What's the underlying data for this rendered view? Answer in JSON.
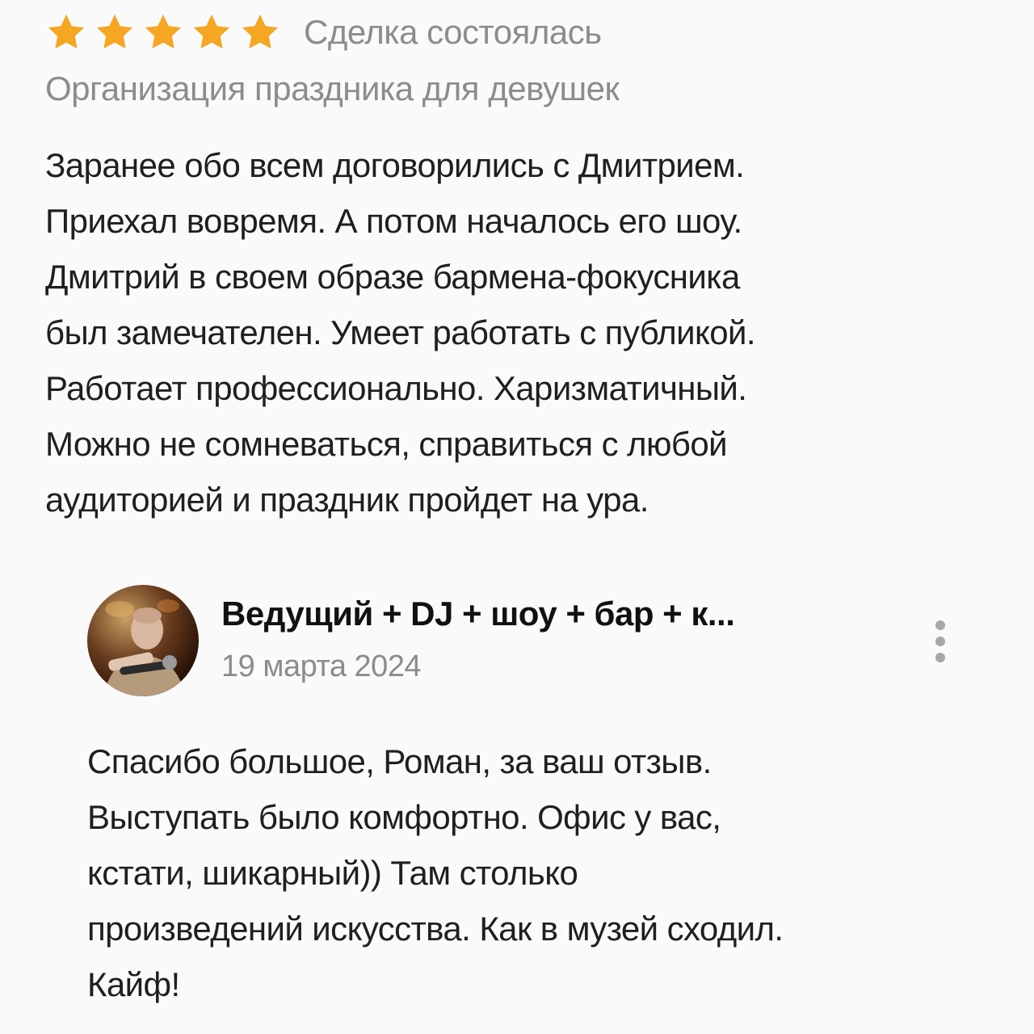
{
  "review": {
    "rating": 5,
    "rating_max": 5,
    "star_color": "#f5a623",
    "deal_status": "Сделка состоялась",
    "category": "Организация праздника для девушек",
    "text_lines": [
      "Заранее обо всем договорились с Дмитрием.",
      "Приехал вовремя. А потом началось его шоу.",
      "Дмитрий в своем образе бармена-фокусника",
      "был замечателен. Умеет работать с публикой.",
      "Работает профессионально. Харизматичный.",
      "Можно не сомневаться, справиться с любой",
      "аудиторией и праздник пройдет на ура."
    ]
  },
  "reply": {
    "author": "Ведущий + DJ + шоу + бар + к...",
    "date": "19 марта 2024",
    "avatar_icon": "performer-photo",
    "more_icon": "vertical-dots-icon",
    "text_lines": [
      "Спасибо большое, Роман, за ваш отзыв.",
      "Выступать было комфортно. Офис у вас,",
      "кстати, шикарный)) Там столько",
      "произведений искусства. Как в музей сходил.",
      "Кайф!"
    ]
  },
  "colors": {
    "secondary_text": "#8c8c8c",
    "primary_text": "#1f1f1f",
    "background": "#fafafa"
  }
}
